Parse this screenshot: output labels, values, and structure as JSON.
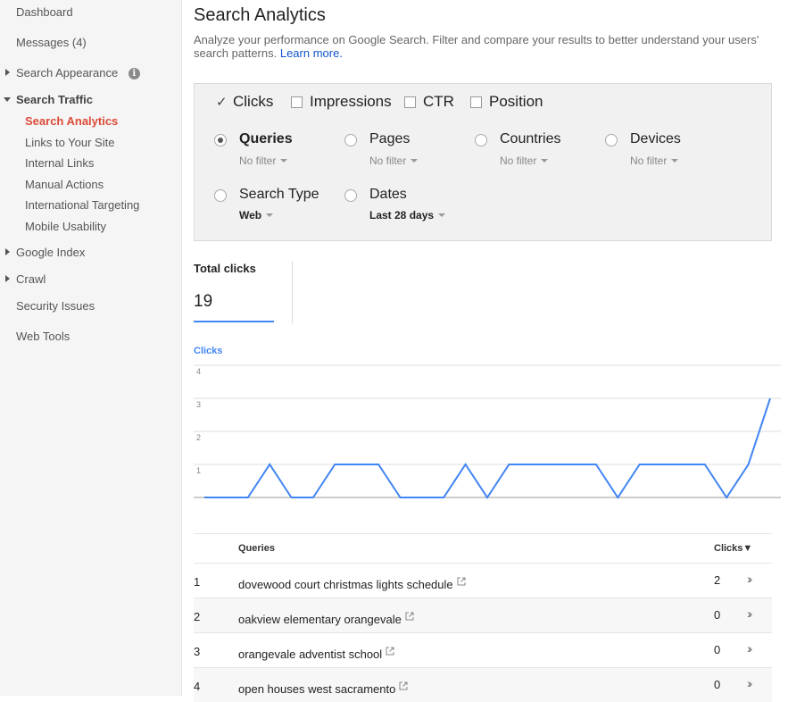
{
  "sidebar": {
    "dashboard": "Dashboard",
    "messages": "Messages (4)",
    "search_appearance": "Search Appearance",
    "info_icon": "info-icon",
    "search_traffic": "Search Traffic",
    "search_analytics": "Search Analytics",
    "links_to_your_site": "Links to Your Site",
    "internal_links": "Internal Links",
    "manual_actions": "Manual Actions",
    "international_targeting": "International Targeting",
    "mobile_usability": "Mobile Usability",
    "google_index": "Google Index",
    "crawl": "Crawl",
    "security_issues": "Security Issues",
    "web_tools": "Web Tools"
  },
  "header": {
    "title": "Search Analytics",
    "description": "Analyze your performance on Google Search. Filter and compare your results to better understand your users' search patterns.",
    "learn_more": "Learn more."
  },
  "metrics": [
    {
      "label": "Clicks",
      "checked": true
    },
    {
      "label": "Impressions",
      "checked": false
    },
    {
      "label": "CTR",
      "checked": false
    },
    {
      "label": "Position",
      "checked": false
    }
  ],
  "dimensions": {
    "queries": {
      "label": "Queries",
      "value": "No filter",
      "selected": true
    },
    "pages": {
      "label": "Pages",
      "value": "No filter"
    },
    "countries": {
      "label": "Countries",
      "value": "No filter"
    },
    "devices": {
      "label": "Devices",
      "value": "No filter"
    },
    "search_type": {
      "label": "Search Type",
      "value": "Web"
    },
    "dates": {
      "label": "Dates",
      "value": "Last 28 days"
    }
  },
  "summary": {
    "total_clicks_label": "Total clicks",
    "total_clicks_value": "19"
  },
  "chart_data": {
    "type": "line",
    "ylabel": "Clicks",
    "yticks": [
      "4",
      "3",
      "2",
      "1"
    ],
    "ylim": [
      0,
      4
    ],
    "grid": true,
    "accent": "#4285f4",
    "series": [
      {
        "name": "Clicks",
        "values": [
          0,
          0,
          0,
          1,
          0,
          0,
          1,
          1,
          1,
          0,
          0,
          0,
          1,
          0,
          1,
          1,
          1,
          1,
          1,
          0,
          1,
          1,
          1,
          1,
          0,
          1,
          3
        ]
      }
    ]
  },
  "table": {
    "col_queries": "Queries",
    "col_clicks": "Clicks",
    "sort_indicator": "▼",
    "rows": [
      {
        "rank": "1",
        "query": "dovewood court christmas lights schedule",
        "clicks": "2"
      },
      {
        "rank": "2",
        "query": "oakview elementary orangevale",
        "clicks": "0"
      },
      {
        "rank": "3",
        "query": "orangevale adventist school",
        "clicks": "0"
      },
      {
        "rank": "4",
        "query": "open houses west sacramento",
        "clicks": "0"
      }
    ]
  }
}
